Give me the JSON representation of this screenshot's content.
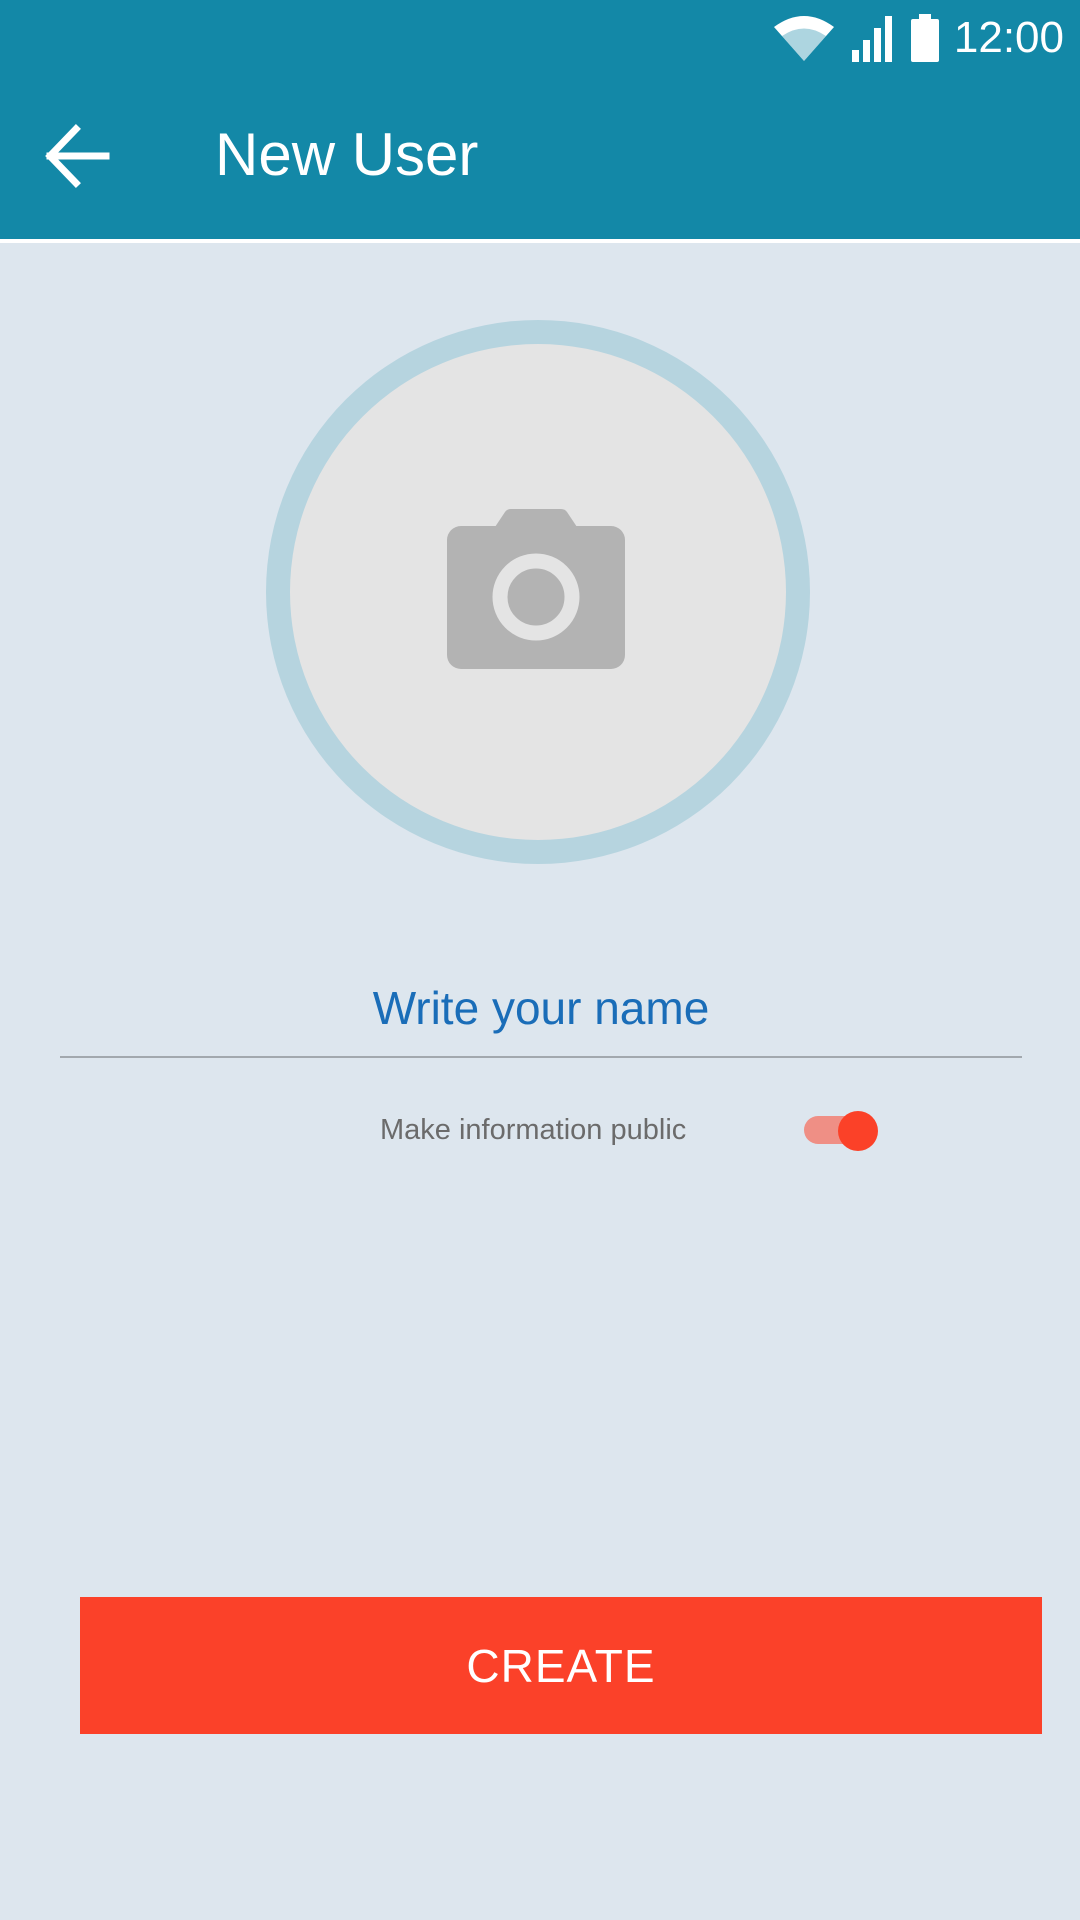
{
  "status_bar": {
    "time": "12:00"
  },
  "app_bar": {
    "title": "New User",
    "back_icon": "arrow-back-icon"
  },
  "avatar": {
    "icon": "camera-icon"
  },
  "name_field": {
    "placeholder": "Write your name",
    "value": ""
  },
  "public_toggle": {
    "label": "Make information public",
    "checked": true
  },
  "create_button": {
    "label": "CREATE"
  },
  "colors": {
    "primary": "#1388a7",
    "accent": "#fb4129",
    "background": "#dde6ee",
    "input_text": "#1a6db8"
  }
}
